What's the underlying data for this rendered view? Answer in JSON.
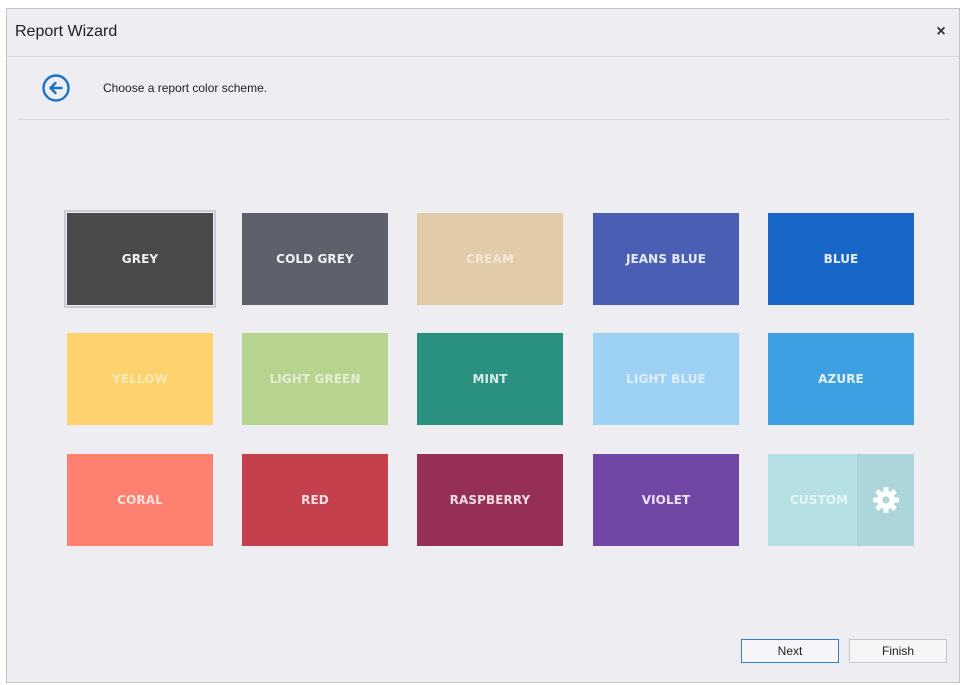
{
  "window": {
    "title": "Report Wizard",
    "close_glyph": "×"
  },
  "header": {
    "back_icon": "arrow-left-circle-icon",
    "subtitle": "Choose a report color scheme."
  },
  "schemes": [
    {
      "id": "grey",
      "label": "GREY",
      "bg": "#4a4a4a",
      "fg": "#f2f2f2",
      "selected": true
    },
    {
      "id": "cold-grey",
      "label": "COLD GREY",
      "bg": "#5e616b",
      "fg": "#f2f2f2",
      "selected": false
    },
    {
      "id": "cream",
      "label": "CREAM",
      "bg": "#e2cba7",
      "fg": "#f3e8d6",
      "selected": false
    },
    {
      "id": "jeans-blue",
      "label": "JEANS BLUE",
      "bg": "#4a5fb3",
      "fg": "#e7ebf7",
      "selected": false
    },
    {
      "id": "blue",
      "label": "BLUE",
      "bg": "#1866c8",
      "fg": "#e6eefa",
      "selected": false
    },
    {
      "id": "yellow",
      "label": "YELLOW",
      "bg": "#fed26e",
      "fg": "#fbe9b8",
      "selected": false
    },
    {
      "id": "light-green",
      "label": "LIGHT GREEN",
      "bg": "#b6d490",
      "fg": "#e3eed3",
      "selected": false
    },
    {
      "id": "mint",
      "label": "MINT",
      "bg": "#2a9180",
      "fg": "#d9eeea",
      "selected": false
    },
    {
      "id": "light-blue",
      "label": "LIGHT BLUE",
      "bg": "#9dd1f4",
      "fg": "#dcefff",
      "selected": false
    },
    {
      "id": "azure",
      "label": "AZURE",
      "bg": "#3ca0e2",
      "fg": "#e4f1fb",
      "selected": false
    },
    {
      "id": "coral",
      "label": "CORAL",
      "bg": "#fe8070",
      "fg": "#fde2dc",
      "selected": false
    },
    {
      "id": "red",
      "label": "RED",
      "bg": "#c4404d",
      "fg": "#f7dfe1",
      "selected": false
    },
    {
      "id": "raspberry",
      "label": "RASPBERRY",
      "bg": "#962f55",
      "fg": "#f2dce4",
      "selected": false
    },
    {
      "id": "violet",
      "label": "VIOLET",
      "bg": "#7147a6",
      "fg": "#ebe2f4",
      "selected": false
    },
    {
      "id": "custom",
      "label": "CUSTOM",
      "bg": "#b6e1e4",
      "fg": "#e8f5f6",
      "selected": false,
      "icon": "gear-icon"
    }
  ],
  "footer": {
    "next_label": "Next",
    "finish_label": "Finish"
  }
}
